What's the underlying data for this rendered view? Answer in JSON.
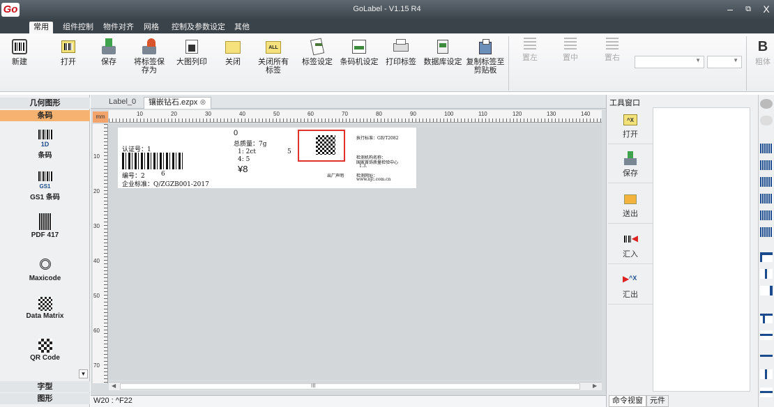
{
  "window": {
    "title": "GoLabel - V1.15 R4",
    "logo": "Go",
    "controls": [
      "–",
      "⧉",
      "X"
    ]
  },
  "menu": [
    "常用",
    "组件控制",
    "物件对齐",
    "网格",
    "控制及参数设定",
    "其他"
  ],
  "ribbon": {
    "buttons": [
      {
        "label": "新建",
        "icon": "new-barcode-icon"
      },
      {
        "label": "打开",
        "icon": "open-icon"
      },
      {
        "label": "保存",
        "icon": "save-icon"
      },
      {
        "label": "将标签保存为",
        "icon": "save-as-icon"
      },
      {
        "label": "大图列印",
        "icon": "poster-print-icon"
      },
      {
        "label": "关闭",
        "icon": "close-folder-icon"
      },
      {
        "label": "关闭所有标签",
        "icon": "close-all-icon",
        "badge": "ALL"
      },
      {
        "label": "标签设定",
        "icon": "label-settings-icon"
      },
      {
        "label": "条码机设定",
        "icon": "printer-settings-icon"
      },
      {
        "label": "打印标签",
        "icon": "print-icon"
      },
      {
        "label": "数据库设定",
        "icon": "database-icon"
      },
      {
        "label": "复制标签至剪贴板",
        "icon": "copy-clipboard-icon"
      }
    ],
    "align": [
      "置左",
      "置中",
      "置右"
    ],
    "bold_label": "粗体",
    "bold_glyph": "B"
  },
  "left_panel": {
    "sections": [
      "几何图形",
      "条码"
    ],
    "items": [
      {
        "label": "条码",
        "badge": "1D"
      },
      {
        "label": "GS1 条码",
        "badge": "GS1"
      },
      {
        "label": "PDF 417"
      },
      {
        "label": "Maxicode"
      },
      {
        "label": "Data Matrix"
      },
      {
        "label": "QR Code"
      }
    ],
    "bottom": [
      "字型",
      "图形"
    ]
  },
  "doc_tabs": [
    {
      "label": "Label_0"
    },
    {
      "label": "镶嵌钻石.ezpx"
    }
  ],
  "ruler": {
    "unit": "mm",
    "h": [
      "10",
      "20",
      "30",
      "40",
      "50",
      "60",
      "70",
      "80",
      "90",
      "100",
      "110",
      "120",
      "130",
      "140"
    ],
    "v": [
      "10",
      "20",
      "30",
      "40",
      "50",
      "60",
      "70"
    ]
  },
  "label_content": {
    "t1": "认证号：1",
    "t2": "编号：2",
    "t3": "6",
    "t4": "企业标准：Q/ZGZB001-2017",
    "t5": "0",
    "t6": "总质量：7g",
    "t7": "1: 2ct",
    "t8": "4: 5",
    "t9": "5",
    "t10": "¥8",
    "t11": "执行标准：GB/T2082",
    "t12": "检测机构名称：",
    "t13": "国家首饰质量检验中心",
    "t14": "1.3.",
    "t15": "出厂声明",
    "t16": "检测网址：",
    "t17": "www.njc.com.cn"
  },
  "status": "W20 : ^F22",
  "scrollbar_mid": "III",
  "tool_window": {
    "title": "工具窗口",
    "buttons": [
      {
        "label": "打开"
      },
      {
        "label": "保存"
      },
      {
        "label": "送出"
      },
      {
        "label": "汇入"
      },
      {
        "label": "汇出"
      }
    ],
    "bottom_tabs": [
      "命令视窗",
      "元件"
    ]
  },
  "colors": {
    "accent": "#f4a46a",
    "selection": "#e0322a",
    "titlebar": "#3c444b"
  }
}
